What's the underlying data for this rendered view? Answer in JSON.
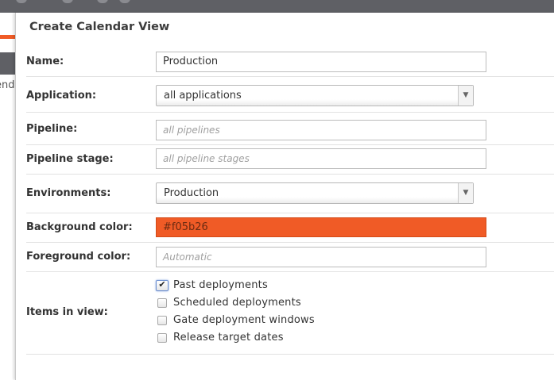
{
  "dialog": {
    "title": "Create Calendar View"
  },
  "underlay": {
    "partial_text": "end"
  },
  "form": {
    "name": {
      "label": "Name:",
      "value": "Production"
    },
    "application": {
      "label": "Application:",
      "selected": "all applications"
    },
    "pipeline": {
      "label": "Pipeline:",
      "placeholder": "all pipelines"
    },
    "pipeline_stage": {
      "label": "Pipeline stage:",
      "placeholder": "all pipeline stages"
    },
    "environments": {
      "label": "Environments:",
      "selected": "Production"
    },
    "background_color": {
      "label": "Background color:",
      "value": "#f05b26",
      "swatch_color": "#f05b26"
    },
    "foreground_color": {
      "label": "Foreground color:",
      "placeholder": "Automatic"
    },
    "items_in_view": {
      "label": "Items in view:",
      "options": [
        {
          "label": "Past deployments",
          "checked": true
        },
        {
          "label": "Scheduled deployments",
          "checked": false
        },
        {
          "label": "Gate deployment windows",
          "checked": false
        },
        {
          "label": "Release target dates",
          "checked": false
        }
      ]
    }
  },
  "icons": {
    "select_arrow": "triangle-down-icon",
    "check": "checkmark-icon"
  }
}
